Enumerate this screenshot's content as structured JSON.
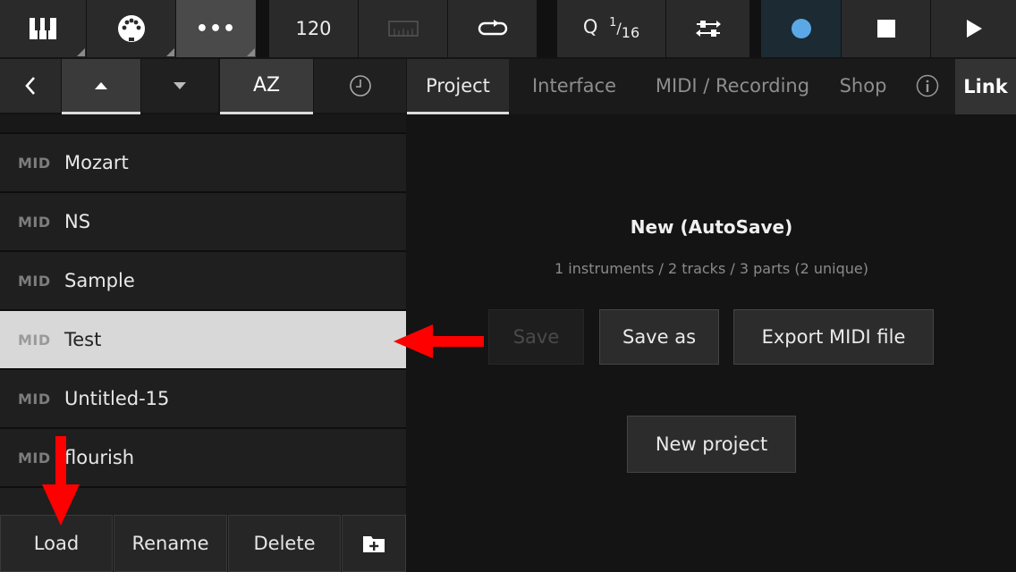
{
  "toolbar": {
    "tempo": "120",
    "quantize_q": "Q",
    "quantize_num": "1",
    "quantize_den": "16"
  },
  "sort_bar": {
    "az_label": "AZ"
  },
  "settings_tabs": [
    {
      "label": "Project"
    },
    {
      "label": "Interface"
    },
    {
      "label": "MIDI / Recording"
    },
    {
      "label": "Shop"
    }
  ],
  "link_label": "Link",
  "file_list": {
    "items": [
      {
        "type": "MID",
        "name": "Mozart"
      },
      {
        "type": "MID",
        "name": "NS"
      },
      {
        "type": "MID",
        "name": "Sample"
      },
      {
        "type": "MID",
        "name": "Test"
      },
      {
        "type": "MID",
        "name": "Untitled-15"
      },
      {
        "type": "MID",
        "name": "flourish"
      }
    ],
    "selected_index": 3
  },
  "bottom_bar": {
    "load": "Load",
    "rename": "Rename",
    "delete": "Delete"
  },
  "project": {
    "title": "New (AutoSave)",
    "summary": "1 instruments / 2 tracks / 3 parts (2 unique)",
    "save": "Save",
    "save_as": "Save as",
    "export": "Export MIDI file",
    "new_project": "New project"
  },
  "colors": {
    "record_dot": "#5aa9e6",
    "annotation_arrow": "#ff0000"
  }
}
